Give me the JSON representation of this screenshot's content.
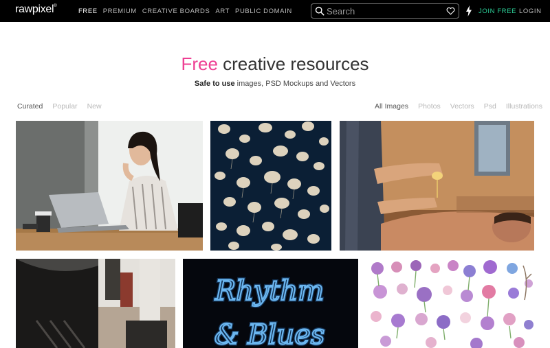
{
  "header": {
    "logo": "rawpixel",
    "nav": [
      {
        "label": "FREE",
        "active": true
      },
      {
        "label": "PREMIUM"
      },
      {
        "label": "CREATIVE BOARDS"
      },
      {
        "label": "ART"
      },
      {
        "label": "PUBLIC DOMAIN"
      }
    ],
    "search_placeholder": "Search",
    "join_label": "JOIN FREE",
    "login_label": "LOGIN"
  },
  "hero": {
    "title_accent": "Free",
    "title_rest": " creative resources",
    "subtitle_bold": "Safe to use",
    "subtitle_rest": " images, PSD Mockups and Vectors"
  },
  "filters": {
    "sort": [
      "Curated",
      "Popular",
      "New"
    ],
    "sort_active": "Curated",
    "types": [
      "All Images",
      "Photos",
      "Vectors",
      "Psd",
      "Illustrations"
    ],
    "types_active": "All Images"
  },
  "colors": {
    "accent_pink": "#ee3f93",
    "join_green": "#2dd29a",
    "topbar": "#000000"
  },
  "images": [
    {
      "name": "woman-with-laptop-photo"
    },
    {
      "name": "jellyfish-photo"
    },
    {
      "name": "massage-oil-photo"
    },
    {
      "name": "office-people-photo"
    },
    {
      "name": "neon-sign-photo",
      "sign_text": [
        "Rhythm",
        "& Blues"
      ]
    },
    {
      "name": "watercolor-flowers-illustration"
    }
  ]
}
